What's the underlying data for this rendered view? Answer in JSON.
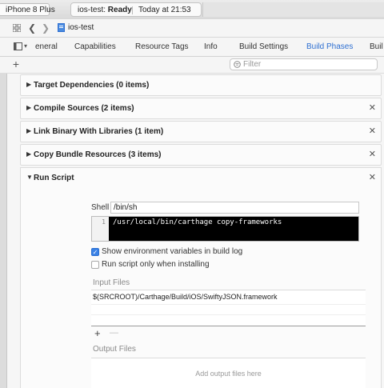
{
  "toolbar": {
    "scheme_device": "iPhone 8 Plus",
    "status_project": "ios-test:",
    "status_state": "Ready",
    "status_time": "Today at 21:53"
  },
  "nav": {
    "breadcrumb": "ios-test"
  },
  "tabs": [
    {
      "label": "eneral"
    },
    {
      "label": "Capabilities"
    },
    {
      "label": "Resource Tags"
    },
    {
      "label": "Info"
    },
    {
      "label": "Build Settings"
    },
    {
      "label": "Build Phases"
    },
    {
      "label": "Buil"
    }
  ],
  "active_tab": "Build Phases",
  "filter": {
    "placeholder": "Filter"
  },
  "phases": [
    {
      "title": "Target Dependencies (0 items)",
      "closable": false
    },
    {
      "title": "Compile Sources (2 items)",
      "closable": true
    },
    {
      "title": "Link Binary With Libraries (1 item)",
      "closable": true
    },
    {
      "title": "Copy Bundle Resources (3 items)",
      "closable": true
    }
  ],
  "run_script": {
    "title": "Run Script",
    "shell_label": "Shell",
    "shell_value": "/bin/sh",
    "line_number": "1",
    "script": "/usr/local/bin/carthage copy-frameworks",
    "option_env_label": "Show environment variables in build log",
    "option_env_checked": true,
    "option_install_label": "Run script only when installing",
    "option_install_checked": false,
    "input_files_label": "Input Files",
    "input_files": [
      "$(SRCROOT)/Carthage/Build/iOS/SwiftyJSON.framework"
    ],
    "add_symbol": "+",
    "remove_symbol": "—",
    "output_files_label": "Output Files",
    "output_files_hint": "Add output files here"
  },
  "colors": {
    "accent": "#2e6fd1",
    "script_bg": "#000000"
  }
}
